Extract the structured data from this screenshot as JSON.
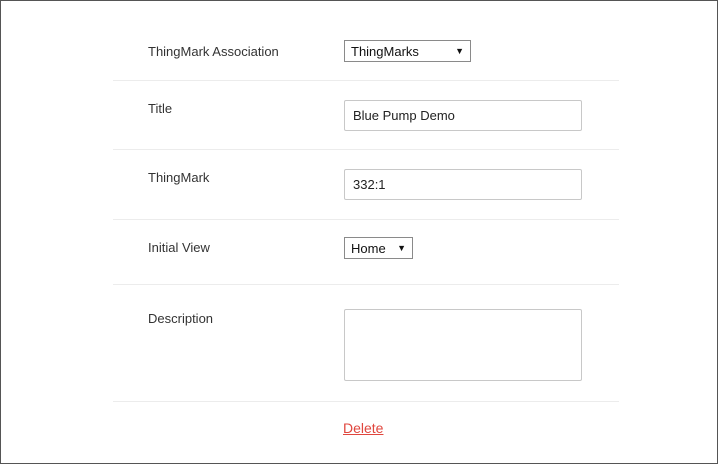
{
  "form": {
    "association": {
      "label": "ThingMark Association",
      "selected": "ThingMarks"
    },
    "title": {
      "label": "Title",
      "value": "Blue Pump Demo"
    },
    "thingmark": {
      "label": "ThingMark",
      "value": "332:1"
    },
    "initial_view": {
      "label": "Initial View",
      "selected": "Home"
    },
    "description": {
      "label": "Description",
      "value": ""
    }
  },
  "actions": {
    "delete_label": "Delete"
  },
  "colors": {
    "delete_link": "#e0463e",
    "border": "#555555",
    "divider": "#ececec"
  }
}
